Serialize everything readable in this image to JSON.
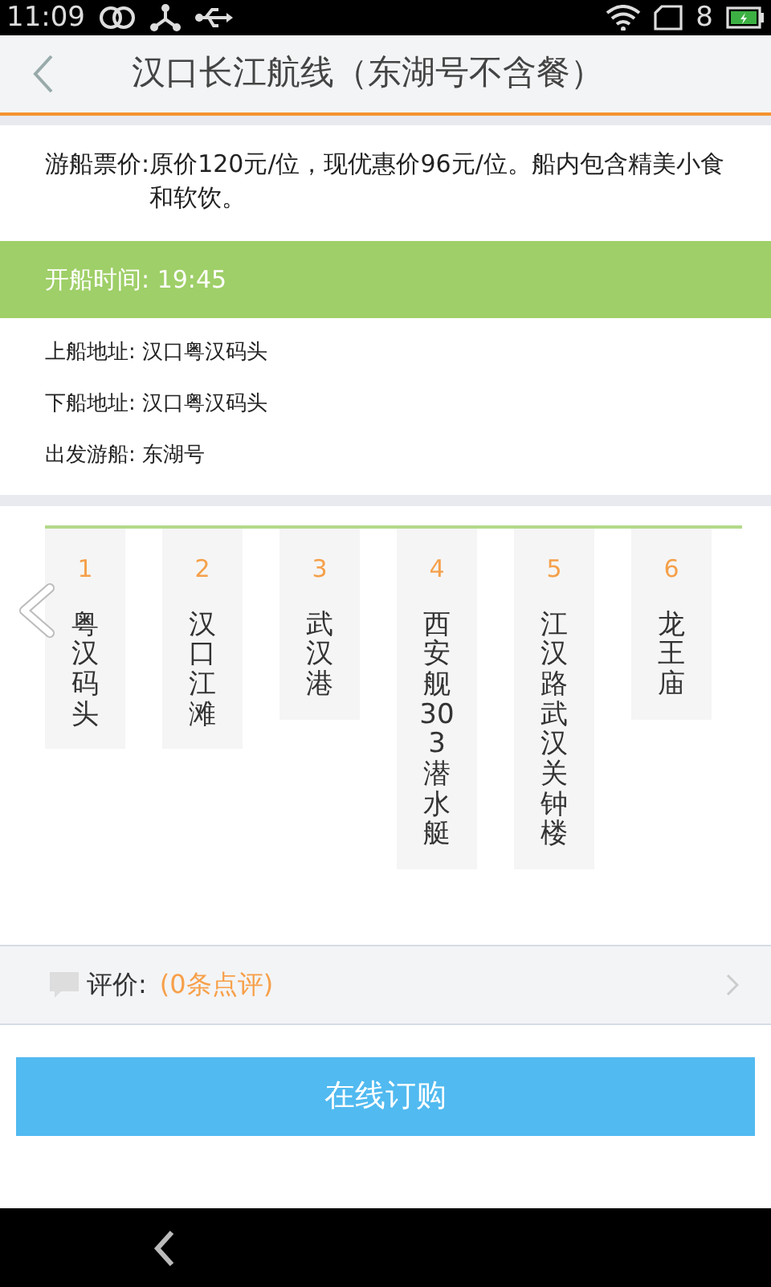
{
  "status_bar": {
    "time": "11:09",
    "notification_count": "8"
  },
  "header": {
    "title": "汉口长江航线（东湖号不含餐）"
  },
  "price": {
    "label": "游船票价:",
    "text": "原价120元/位，现优惠价96元/位。船内包含精美小食和软饮。"
  },
  "departure": {
    "text": "开船时间: 19:45"
  },
  "info_rows": [
    {
      "text": "上船地址: 汉口粤汉码头"
    },
    {
      "text": "下船地址: 汉口粤汉码头"
    },
    {
      "text": "出发游船: 东湖号"
    }
  ],
  "stops": [
    {
      "number": "1",
      "name": "粤汉码头"
    },
    {
      "number": "2",
      "name": "汉口江滩"
    },
    {
      "number": "3",
      "name": "武汉港"
    },
    {
      "number": "4",
      "name": "西安舰303潜水艇"
    },
    {
      "number": "5",
      "name": "江汉路武汉关钟楼"
    },
    {
      "number": "6",
      "name": "龙王庙"
    }
  ],
  "review": {
    "label": "评价:",
    "count": "(0条点评)"
  },
  "order_button": {
    "label": "在线订购"
  }
}
